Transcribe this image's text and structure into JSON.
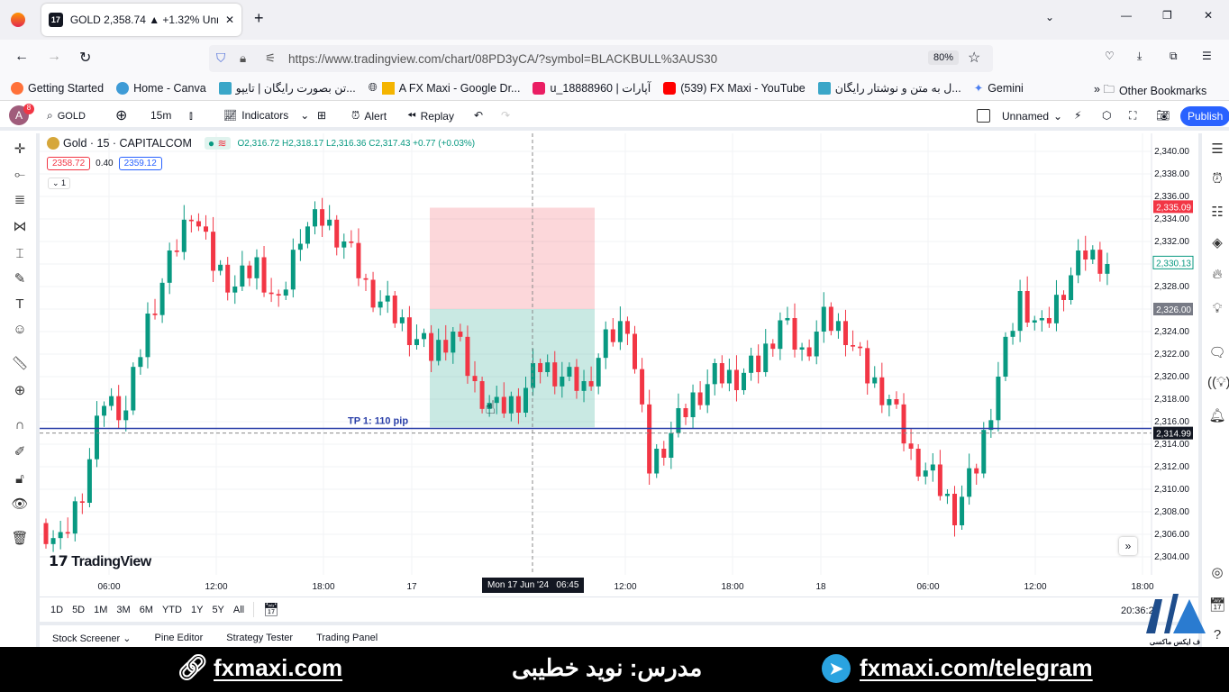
{
  "browser": {
    "tab_title": "GOLD 2,358.74 ▲ +1.32% Unna",
    "url": "https://www.tradingview.com/chart/08PD3yCA/?symbol=BLACKBULL%3AUS30",
    "zoom": "80%",
    "bookmarks": [
      "Getting Started",
      "Home - Canva",
      "تن بصورت رایگان | تایپو...",
      "A FX Maxi - Google Dr...",
      "u_18888960 | آپارات",
      "(539) FX Maxi - YouTube",
      "ل به متن و نوشتار رایگان...",
      "Gemini"
    ],
    "other_bookmarks": "Other Bookmarks"
  },
  "toolbar": {
    "avatar": "A",
    "badge": "8",
    "symbol": "GOLD",
    "interval": "15m",
    "indicators": "Indicators",
    "alert": "Alert",
    "replay": "Replay",
    "layout_name": "Unnamed",
    "publish": "Publish"
  },
  "legend": {
    "title": "Gold · 15 · CAPITALCOM",
    "open": "O2,316.72",
    "high": "H2,318.17",
    "low": "L2,316.36",
    "close": "C2,317.43",
    "change": "+0.77 (+0.03%)",
    "sell": "2358.72",
    "spread": "0.40",
    "buy": "2359.12",
    "collapse": "1"
  },
  "chart_data": {
    "type": "candlestick",
    "ylim": [
      2303,
      2341
    ],
    "price_ticks": [
      "2,340.00",
      "2,338.00",
      "2,336.00",
      "2,334.00",
      "2,332.00",
      "2,330.00",
      "2,328.00",
      "2,326.00",
      "2,324.00",
      "2,322.00",
      "2,320.00",
      "2,318.00",
      "2,316.00",
      "2,314.00",
      "2,312.00",
      "2,310.00",
      "2,308.00",
      "2,306.00",
      "2,304.00"
    ],
    "time_ticks": [
      "06:00",
      "12:00",
      "18:00",
      "17",
      "12:00",
      "18:00",
      "18",
      "06:00",
      "12:00",
      "18:00"
    ],
    "closes": [
      2307,
      2305,
      2310,
      2318,
      2317,
      2325,
      2330,
      2335,
      2330,
      2328,
      2330,
      2326,
      2333,
      2334,
      2332,
      2328,
      2326,
      2324,
      2322,
      2324,
      2319,
      2317,
      2318,
      2321,
      2320,
      2319,
      2323,
      2325,
      2312,
      2315,
      2318,
      2320,
      2320,
      2321,
      2325,
      2322,
      2325,
      2324,
      2320,
      2318,
      2313,
      2311,
      2308,
      2312,
      2320,
      2327,
      2324,
      2328,
      2331,
      2330
    ],
    "price_labels": {
      "stop": "2,335.09",
      "last": "2,330.13",
      "entry": "2,326.00",
      "crosshair": "2,314.99"
    },
    "crosshair_time": "Mon 17 Jun '24   06:45",
    "position": {
      "entry": 2326,
      "stop": 2335,
      "target": 2315.5,
      "label": "TP 1: 110 pip"
    },
    "colors": {
      "up": "#089981",
      "down": "#f23645",
      "line": "#2a3fa8"
    }
  },
  "watermark": "TradingView",
  "ranges": [
    "1D",
    "5D",
    "1M",
    "3M",
    "6M",
    "YTD",
    "1Y",
    "5Y",
    "All"
  ],
  "clock": "20:36:2",
  "panels": [
    "Stock Screener",
    "Pine Editor",
    "Strategy Tester",
    "Trading Panel"
  ],
  "footer": {
    "site": "fxmaxi.com",
    "teacher": "مدرس: نوید خطیبی",
    "telegram": "fxmaxi.com/telegram",
    "logo_text": "ف ایکس ماکسی"
  }
}
